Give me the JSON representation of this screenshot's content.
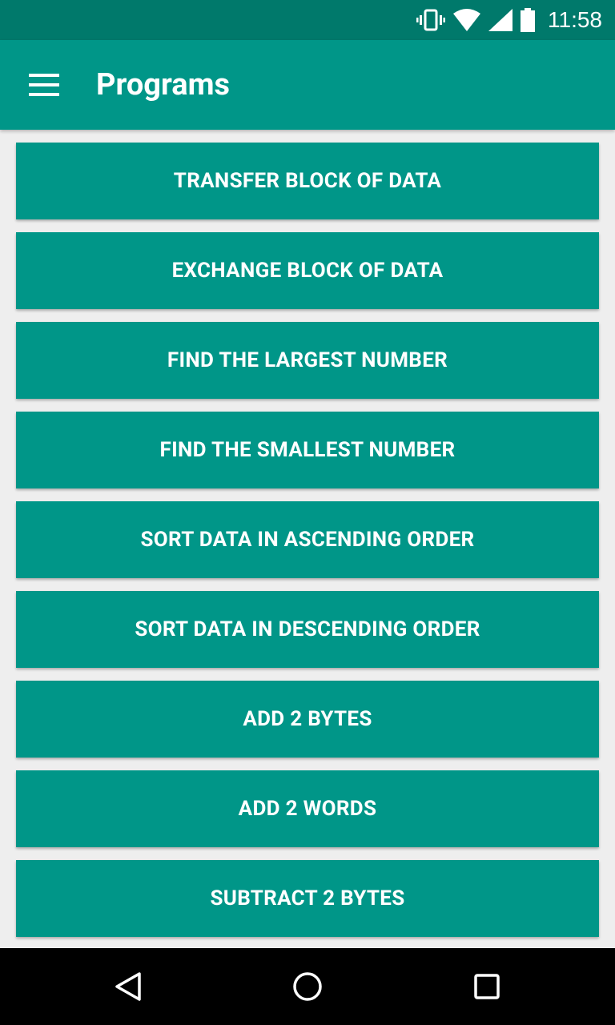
{
  "status_bar": {
    "time": "11:58",
    "icons": [
      "vibrate-icon",
      "wifi-icon",
      "signal-icon",
      "battery-icon"
    ]
  },
  "app_bar": {
    "menu_icon": "hamburger-menu-icon",
    "title": "Programs"
  },
  "programs": [
    {
      "label": "TRANSFER BLOCK OF DATA"
    },
    {
      "label": "EXCHANGE BLOCK OF DATA"
    },
    {
      "label": "FIND THE LARGEST NUMBER"
    },
    {
      "label": "FIND THE SMALLEST NUMBER"
    },
    {
      "label": "SORT DATA IN ASCENDING ORDER"
    },
    {
      "label": "SORT DATA IN DESCENDING ORDER"
    },
    {
      "label": "ADD 2 BYTES"
    },
    {
      "label": "ADD 2 WORDS"
    },
    {
      "label": "SUBTRACT 2 BYTES"
    }
  ],
  "nav_bar": {
    "icons": [
      "back-icon",
      "home-icon",
      "recents-icon"
    ]
  },
  "colors": {
    "status_bar": "#00796b",
    "primary": "#009688",
    "background": "#eeeeee",
    "nav_bar": "#000000"
  }
}
